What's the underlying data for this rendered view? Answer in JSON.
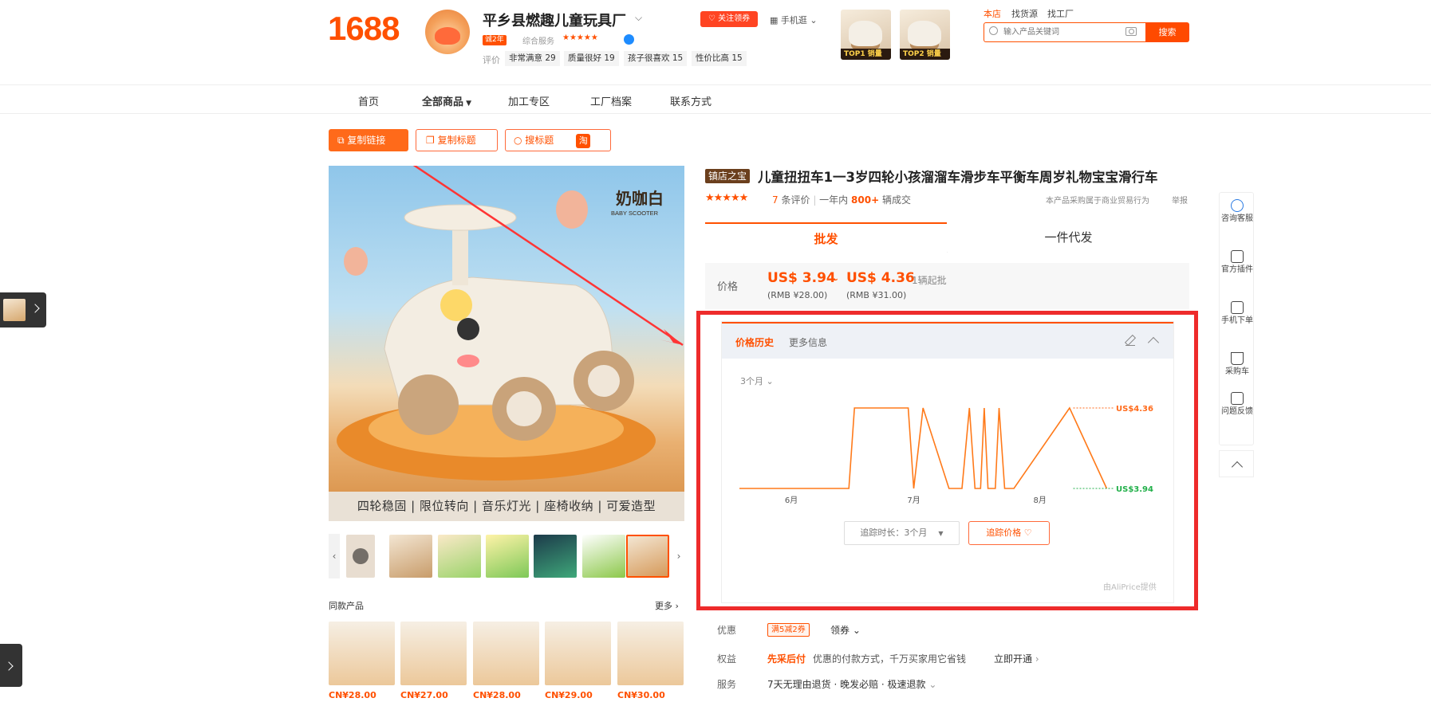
{
  "header": {
    "logo": "1688",
    "shop_name": "平乡县燃趣儿童玩具厂",
    "years_badge": "诚2年",
    "service_label": "综合服务",
    "service_stars": "★★★★★",
    "eval_label": "评价",
    "eval_tags": [
      "非常满意 29",
      "质量很好 19",
      "孩子很喜欢 15",
      "性价比高 15"
    ],
    "follow_label": "关注领券",
    "mobile_label": "手机逛",
    "top_thumbs": [
      {
        "rank": "TOP1 销量"
      },
      {
        "rank": "TOP2 销量"
      }
    ],
    "search_tabs": [
      "本店",
      "找货源",
      "找工厂"
    ],
    "search_placeholder": "输入产品关键词",
    "search_button": "搜索"
  },
  "nav": {
    "items": [
      "首页",
      "全部商品",
      "加工专区",
      "工厂档案",
      "联系方式"
    ]
  },
  "actions": {
    "copy_link": "复制链接",
    "copy_title": "复制标题",
    "search_title": "搜标题",
    "taobao": "淘"
  },
  "gallery": {
    "brand_text": "奶咖白",
    "brand_sub": "BABY SCOOTER",
    "caption": "四轮稳固 | 限位转向 | 音乐灯光 | 座椅收纳 | 可爱造型",
    "same_title": "同款产品",
    "same_more": "更多",
    "same_prices": [
      "CN¥28.00",
      "CN¥27.00",
      "CN¥28.00",
      "CN¥29.00",
      "CN¥30.00"
    ]
  },
  "product": {
    "badge": "镇店之宝",
    "title": "儿童扭扭车1一3岁四轮小孩溜溜车滑步车平衡车周岁礼物宝宝滑行车",
    "stars": "★★★★★",
    "review_count": "7",
    "review_suffix": "条评价",
    "year_label": "一年内",
    "sold_count": "800+",
    "sold_suffix": "辆成交",
    "notice": "本产品采购属于商业贸易行为",
    "report": "举报",
    "tab_wholesale": "批发",
    "tab_dropship": "一件代发",
    "price_label": "价格",
    "price_low": "US$ 3.94",
    "price_sep": "~",
    "price_high": "US$ 4.36",
    "rmb_low": "(RMB ¥28.00)",
    "rmb_high": "(RMB ¥31.00)",
    "moq": "1辆起批"
  },
  "history": {
    "tab_active": "价格历史",
    "tab_more": "更多信息",
    "range": "3个月",
    "track_select": "追踪时长：3个月",
    "track_button": "追踪价格 ♡",
    "provider": "由AliPrice提供"
  },
  "chart_data": {
    "type": "line",
    "title": "",
    "xlabel": "",
    "ylabel": "",
    "x_ticks": [
      "6月",
      "7月",
      "8月"
    ],
    "ylim": [
      3.94,
      4.36
    ],
    "max_label": "US$4.36",
    "min_label": "US$3.94",
    "series": [
      {
        "color": "#ff7a1a",
        "points": [
          [
            0.0,
            3.94
          ],
          [
            0.295,
            3.94
          ],
          [
            0.31,
            4.36
          ],
          [
            0.455,
            4.36
          ],
          [
            0.47,
            3.94
          ],
          [
            0.495,
            4.36
          ],
          [
            0.565,
            3.94
          ],
          [
            0.6,
            3.94
          ],
          [
            0.62,
            4.36
          ],
          [
            0.635,
            3.94
          ],
          [
            0.65,
            3.94
          ],
          [
            0.66,
            4.36
          ],
          [
            0.67,
            3.94
          ],
          [
            0.69,
            3.94
          ],
          [
            0.7,
            4.36
          ],
          [
            0.715,
            3.94
          ],
          [
            0.74,
            3.94
          ],
          [
            0.89,
            4.36
          ],
          [
            0.99,
            3.94
          ]
        ]
      }
    ],
    "x_tick_positions": [
      0.14,
      0.47,
      0.81
    ],
    "grid": false
  },
  "offers": {
    "coupon_label": "优惠",
    "coupon_tag": "满5减2券",
    "coupon_link": "领券",
    "benefit_label": "权益",
    "benefit_red": "先采后付",
    "benefit_text": "优惠的付款方式，千万买家用它省钱",
    "benefit_open": "立即开通",
    "service_label": "服务",
    "service_text": "7天无理由退货 · 晚发必赔 · 极速退款"
  },
  "side": {
    "items": [
      "咨询客服",
      "官方插件",
      "手机下单",
      "采购车",
      "问题反馈"
    ]
  }
}
